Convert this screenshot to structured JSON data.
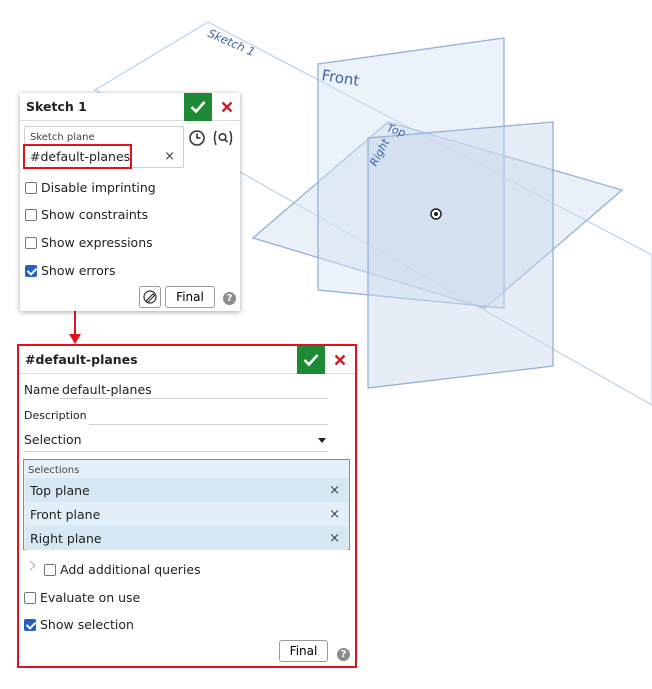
{
  "viewport": {
    "plane_labels": {
      "sketch": "Sketch 1",
      "front": "Front",
      "top": "Top",
      "right": "Right"
    }
  },
  "sketch_panel": {
    "title": "Sketch 1",
    "sketch_plane_label": "Sketch plane",
    "sketch_plane_value": "#default-planes",
    "options": [
      {
        "label": "Disable imprinting",
        "checked": false
      },
      {
        "label": "Show constraints",
        "checked": false
      },
      {
        "label": "Show expressions",
        "checked": false
      },
      {
        "label": "Show errors",
        "checked": true
      }
    ],
    "final_label": "Final"
  },
  "query_panel": {
    "title": "#default-planes",
    "name_label": "Name",
    "name_value": "default-planes",
    "description_label": "Description",
    "description_value": "",
    "type_value": "Selection",
    "selections_label": "Selections",
    "selections": [
      "Top plane",
      "Front plane",
      "Right plane"
    ],
    "add_queries_label": "Add additional queries",
    "evaluate_on_use_label": "Evaluate on use",
    "evaluate_on_use_checked": false,
    "show_selection_label": "Show selection",
    "show_selection_checked": true,
    "final_label": "Final"
  },
  "colors": {
    "accept_green": "#1e8a35",
    "cancel_red": "#c8202a",
    "highlight_red": "#e3101d",
    "selection_blue": "#d9e9f6",
    "checkbox_blue": "#2360c4"
  }
}
